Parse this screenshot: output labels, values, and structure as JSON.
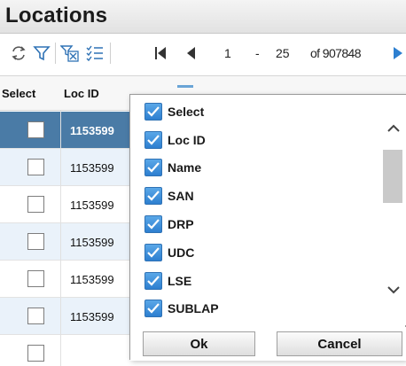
{
  "window": {
    "title": "Locations"
  },
  "toolbar": {
    "icons": [
      "refresh-sync-icon",
      "filter-icon",
      "clear-filter-icon",
      "column-chooser-icon",
      "first-page-icon",
      "previous-page-icon",
      "next-page-icon"
    ],
    "pager": {
      "range_start": "1",
      "range_sep": "-",
      "range_end": "25",
      "of_total": "of 907848"
    }
  },
  "table": {
    "columns": [
      "Select",
      "Loc ID"
    ],
    "rows": [
      {
        "loc_id": "1153599",
        "selected": true
      },
      {
        "loc_id": "1153599",
        "selected": false
      },
      {
        "loc_id": "1153599",
        "selected": false
      },
      {
        "loc_id": "1153599",
        "selected": false
      },
      {
        "loc_id": "1153599",
        "selected": false
      },
      {
        "loc_id": "1153599",
        "selected": false
      }
    ]
  },
  "column_chooser": {
    "items": [
      {
        "label": "Select",
        "checked": true
      },
      {
        "label": "Loc ID",
        "checked": true
      },
      {
        "label": "Name",
        "checked": true
      },
      {
        "label": "SAN",
        "checked": true
      },
      {
        "label": "DRP",
        "checked": true
      },
      {
        "label": "UDC",
        "checked": true
      },
      {
        "label": "LSE",
        "checked": true
      },
      {
        "label": "SUBLAP",
        "checked": true
      }
    ],
    "ok_label": "Ok",
    "cancel_label": "Cancel"
  },
  "colors": {
    "selected_row": "#4a7ba6",
    "alt_row": "#eaf2fa",
    "accent": "#2d7fd0"
  }
}
